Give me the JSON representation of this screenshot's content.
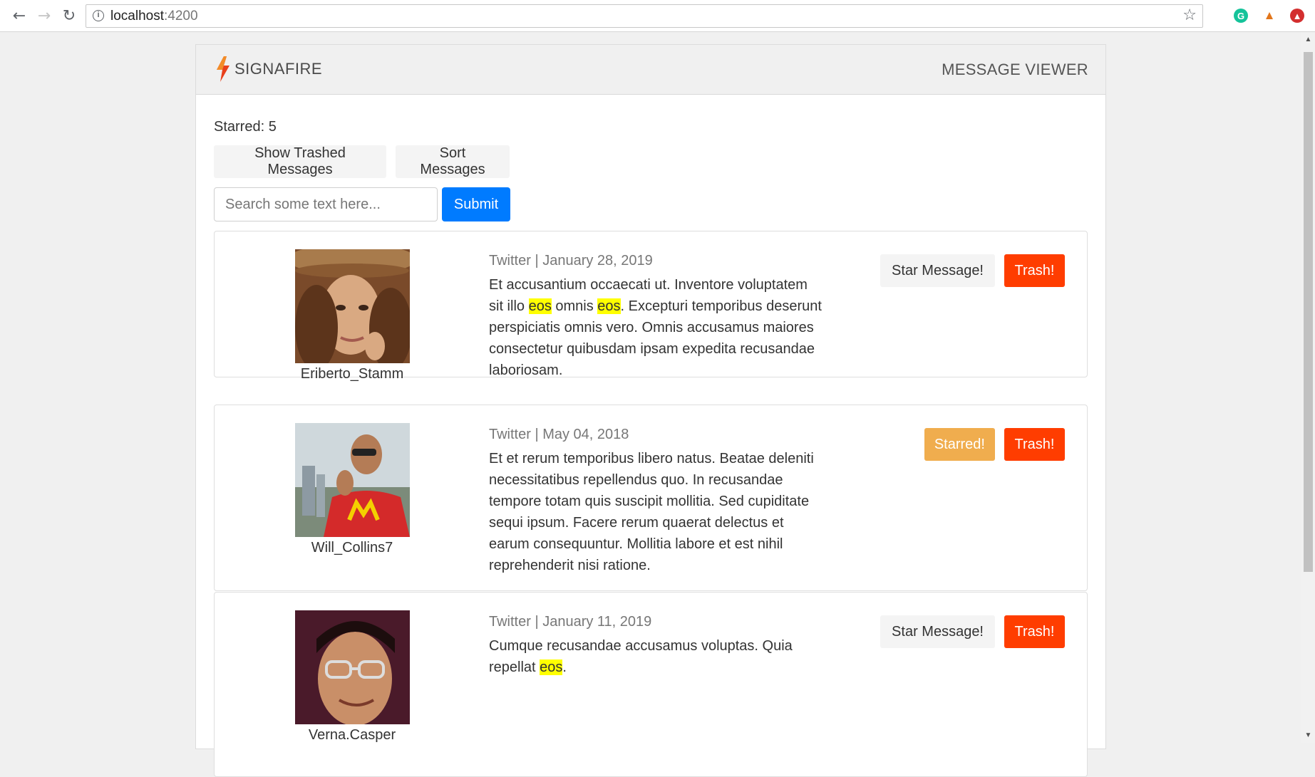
{
  "browser": {
    "url_host": "localhost",
    "url_port": ":4200"
  },
  "header": {
    "brand": "SIGNAFIRE",
    "title": "MESSAGE VIEWER"
  },
  "toolbar": {
    "starred_count": "Starred: 5",
    "show_trashed_label": "Show Trashed Messages",
    "sort_label": "Sort Messages",
    "search_placeholder": "Search some text here...",
    "submit_label": "Submit"
  },
  "messages": [
    {
      "username": "Eriberto_Stamm",
      "meta": "Twitter | January 28, 2019",
      "text_parts": [
        "Et accusantium occaecati ut. Inventore voluptatem sit illo ",
        "eos",
        " omnis ",
        "eos",
        ". Excepturi temporibus deserunt perspiciatis omnis vero. Omnis accusamus maiores consectetur quibusdam ipsam expedita recusandae laboriosam."
      ],
      "star_label": "Star Message!",
      "starred": false,
      "trash_label": "Trash!"
    },
    {
      "username": "Will_Collins7",
      "meta": "Twitter | May 04, 2018",
      "text_parts": [
        "Et et rerum temporibus libero natus. Beatae deleniti necessitatibus repellendus quo. In recusandae tempore totam quis suscipit mollitia. Sed cupiditate sequi ipsum. Facere rerum quaerat delectus et earum consequuntur. Mollitia labore et est nihil reprehenderit nisi ratione."
      ],
      "star_label": "Starred!",
      "starred": true,
      "trash_label": "Trash!"
    },
    {
      "username": "Verna.Casper",
      "meta": "Twitter | January 11, 2019",
      "text_parts": [
        "Cumque recusandae accusamus voluptas. Quia repellat ",
        "eos",
        "."
      ],
      "star_label": "Star Message!",
      "starred": false,
      "trash_label": "Trash!"
    }
  ],
  "colors": {
    "primary": "#007bff",
    "starred": "#f0ad4e",
    "trash": "#ff3d00",
    "highlight": "#ffff00"
  }
}
